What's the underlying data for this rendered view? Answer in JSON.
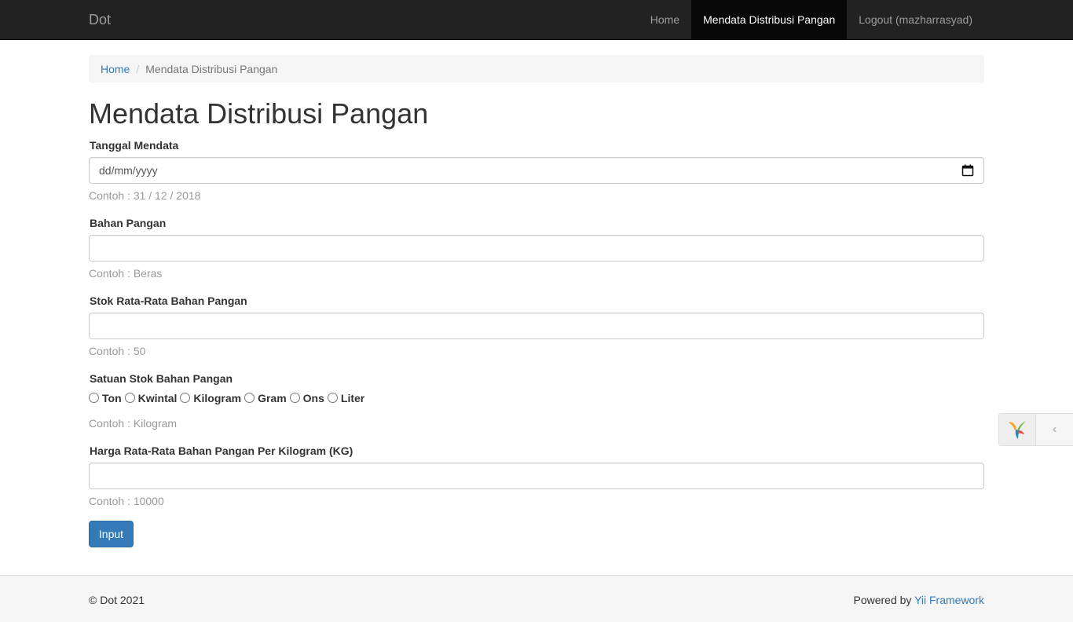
{
  "navbar": {
    "brand": "Dot",
    "items": [
      {
        "label": "Home",
        "active": false
      },
      {
        "label": "Mendata Distribusi Pangan",
        "active": true
      },
      {
        "label": "Logout (mazharrasyad)",
        "active": false
      }
    ]
  },
  "breadcrumb": {
    "home": "Home",
    "current": "Mendata Distribusi Pangan"
  },
  "page": {
    "title": "Mendata Distribusi Pangan"
  },
  "form": {
    "tanggal": {
      "label": "Tanggal Mendata",
      "placeholder": "dd/mm/yyyy",
      "hint": "Contoh : 31 / 12 / 2018"
    },
    "bahan": {
      "label": "Bahan Pangan",
      "value": "",
      "hint": "Contoh : Beras"
    },
    "stok": {
      "label": "Stok Rata-Rata Bahan Pangan",
      "value": "",
      "hint": "Contoh : 50"
    },
    "satuan": {
      "label": "Satuan Stok Bahan Pangan",
      "options": [
        "Ton",
        "Kwintal",
        "Kilogram",
        "Gram",
        "Ons",
        "Liter"
      ],
      "hint": "Contoh : Kilogram"
    },
    "harga": {
      "label": "Harga Rata-Rata Bahan Pangan Per Kilogram (KG)",
      "value": "",
      "hint": "Contoh : 10000"
    },
    "submit_label": "Input"
  },
  "footer": {
    "copyright": "© Dot 2021",
    "powered_prefix": "Powered by ",
    "powered_link": "Yii Framework"
  },
  "debug_toolbar": {
    "logo_icon": "yii-logo-icon",
    "toggle_icon": "chevron-left-icon",
    "toggle_glyph": "‹"
  }
}
